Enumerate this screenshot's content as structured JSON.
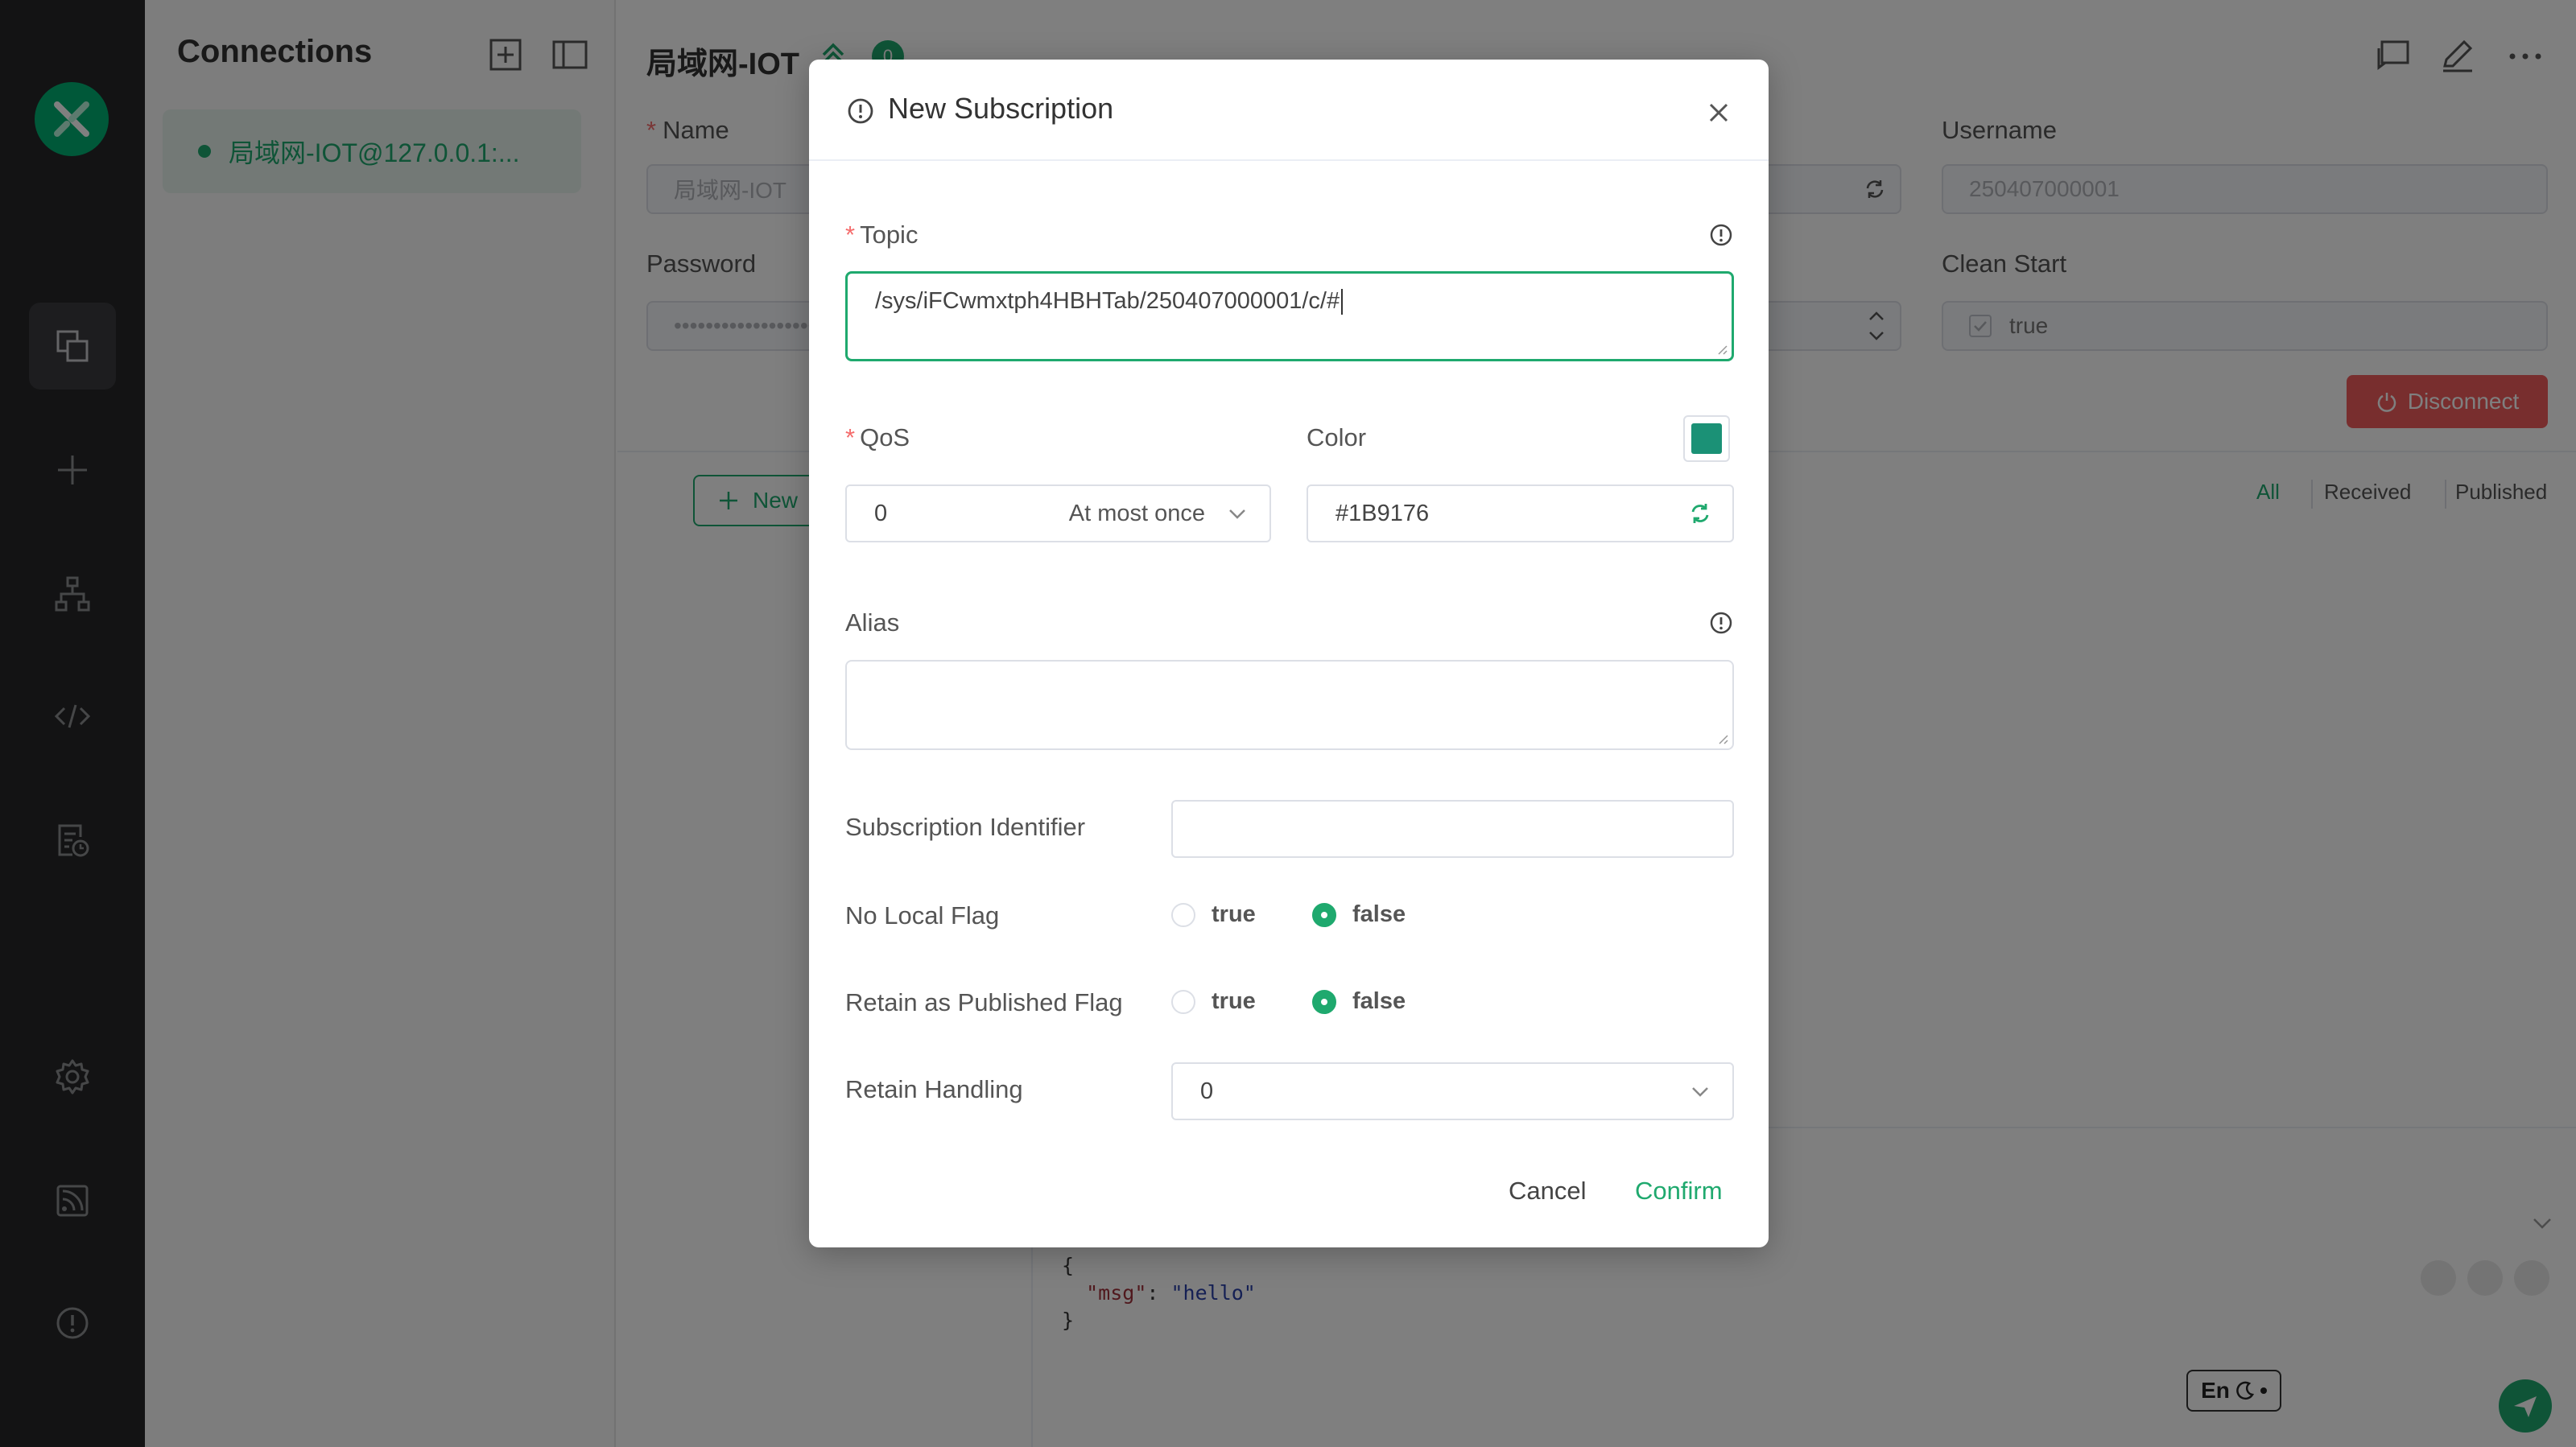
{
  "app": {
    "sidebar_title": "Connections",
    "connection_item": "局域网-IOT@127.0.0.1:...",
    "main_title": "局域网-IOT",
    "badge_count": "0"
  },
  "main": {
    "name_label": "Name",
    "name_value": "局域网-IOT",
    "username_label": "Username",
    "username_value": "250407000001",
    "password_label": "Password",
    "password_value": "••••••••••••••••••",
    "clean_start_label": "Clean Start",
    "clean_start_value": "true",
    "disconnect_label": "Disconnect",
    "new_subscription_label": "New",
    "tabs": [
      "All",
      "Received",
      "Published"
    ],
    "payload_lines": [
      "{",
      "  \"msg\": \"hello\"",
      "}"
    ],
    "payload_key": "\"msg\"",
    "payload_value": "\"hello\"",
    "input_method": "En"
  },
  "modal": {
    "title": "New Subscription",
    "topic_label": "Topic",
    "topic_value": "/sys/iFCwmxtph4HBHTab/250407000001/c/#",
    "qos_label": "QoS",
    "qos_value": "0",
    "qos_desc": "At most once",
    "color_label": "Color",
    "color_value": "#1B9176",
    "alias_label": "Alias",
    "alias_value": "",
    "sub_id_label": "Subscription Identifier",
    "sub_id_value": "",
    "no_local_label": "No Local Flag",
    "rap_label": "Retain as Published Flag",
    "true_label": "true",
    "false_label": "false",
    "retain_handling_label": "Retain Handling",
    "retain_handling_value": "0",
    "cancel_label": "Cancel",
    "confirm_label": "Confirm"
  },
  "colors": {
    "accent": "#1fa96e",
    "subscription_color": "#1B9176",
    "danger": "#f05d5d"
  },
  "icons": {
    "nav": [
      "connections-icon",
      "plus-icon",
      "topology-icon",
      "code-icon",
      "log-icon",
      "gear-icon",
      "feed-icon",
      "info-icon"
    ]
  }
}
